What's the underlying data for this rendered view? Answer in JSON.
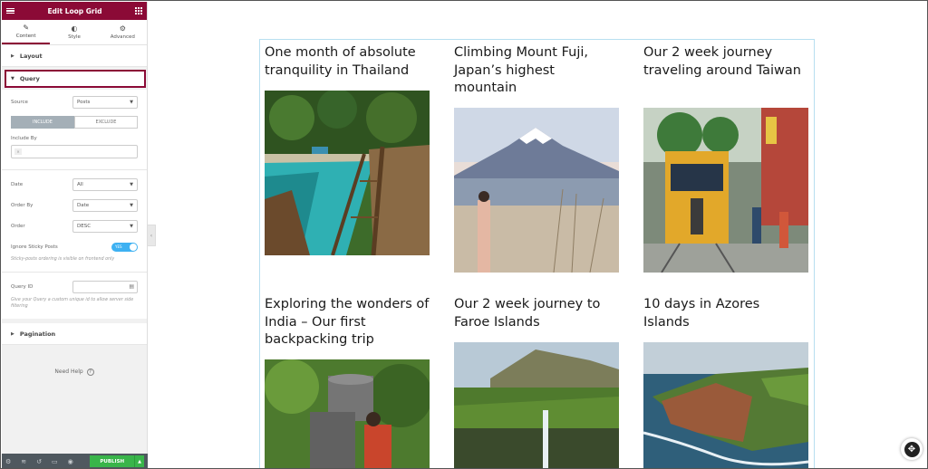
{
  "panel": {
    "title": "Edit Loop Grid",
    "tabs": [
      {
        "label": "Content",
        "icon": "pencil-icon"
      },
      {
        "label": "Style",
        "icon": "half-circle-icon"
      },
      {
        "label": "Advanced",
        "icon": "gear-icon"
      }
    ],
    "sections": {
      "layout": "Layout",
      "query": "Query",
      "pagination": "Pagination"
    },
    "query": {
      "source_label": "Source",
      "source_value": "Posts",
      "include_tab": "INCLUDE",
      "exclude_tab": "EXCLUDE",
      "include_by_label": "Include By",
      "date_label": "Date",
      "date_value": "All",
      "order_by_label": "Order By",
      "order_by_value": "Date",
      "order_label": "Order",
      "order_value": "DESC",
      "sticky_label": "Ignore Sticky Posts",
      "sticky_toggle": "YES",
      "sticky_note": "Sticky-posts ordering is visible on frontend only",
      "query_id_label": "Query ID",
      "query_id_note": "Give your Query a custom unique id to allow server side filtering"
    },
    "need_help": "Need Help",
    "publish": "PUBLISH",
    "accent_color": "#8b0a36"
  },
  "posts": [
    {
      "title": "One month of absolute tranquility in Thailand",
      "image": "thailand-boardwalk"
    },
    {
      "title": "Climbing Mount Fuji, Japan’s highest mountain",
      "image": "mount-fuji-lake"
    },
    {
      "title": "Our 2 week journey traveling around Taiwan",
      "image": "taiwan-train"
    },
    {
      "title": "Exploring the wonders of India – Our first backpacking trip",
      "image": "india-basket"
    },
    {
      "title": "Our 2 week journey to Faroe Islands",
      "image": "faroe-cliffs"
    },
    {
      "title": "10 days in Azores Islands",
      "image": "azores-coast"
    }
  ]
}
